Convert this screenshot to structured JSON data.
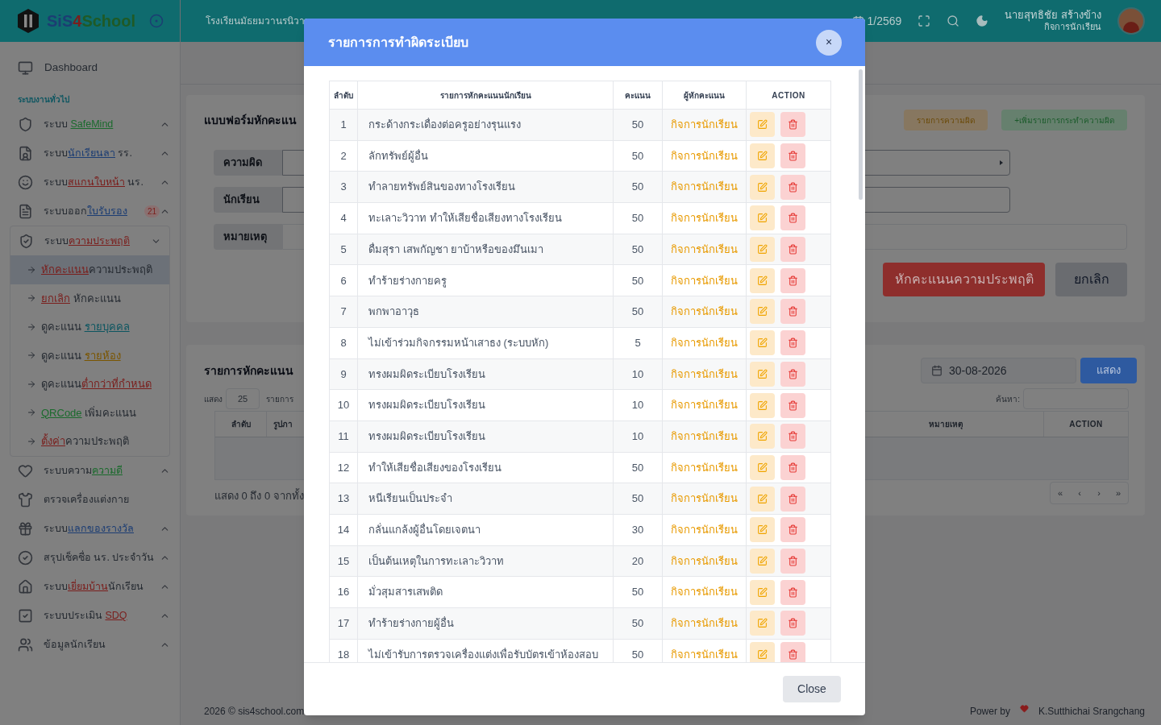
{
  "brand": {
    "parts": [
      {
        "text": "SiS",
        "color": "#1c3d73"
      },
      {
        "text": "4",
        "color": "#7a1e1c"
      },
      {
        "text": "School",
        "color": "#1f5a26"
      }
    ]
  },
  "topbar": {
    "school": "โรงเรียนมัธยมวานรนิวา",
    "term": "1/2569",
    "user_name": "นายสุทธิชัย สร้างข้าง",
    "user_role": "กิจการนักเรียน"
  },
  "sidebar": {
    "dashboard": "Dashboard",
    "section": "ระบบงานทั่วไป",
    "items": [
      {
        "kind": "group",
        "expanded": false,
        "parts": [
          {
            "text": "ระบบ "
          },
          {
            "text": "SafeMind",
            "color": "#1a6a2c"
          }
        ]
      },
      {
        "kind": "group",
        "expanded": false,
        "parts": [
          {
            "text": "ระบบ"
          },
          {
            "text": "นักเรียนลา",
            "color": "#1c3d73"
          },
          {
            "text": " รร."
          }
        ]
      },
      {
        "kind": "group",
        "expanded": false,
        "parts": [
          {
            "text": "ระบบ"
          },
          {
            "text": "สแกนใบหน้า",
            "color": "#7a1e1c"
          },
          {
            "text": " นร."
          }
        ]
      },
      {
        "kind": "group",
        "expanded": false,
        "badge": "21",
        "parts": [
          {
            "text": "ระบบออก"
          },
          {
            "text": "ใบรับรอง",
            "color": "#1c3d73"
          }
        ]
      },
      {
        "kind": "group",
        "expanded": true,
        "parts": [
          {
            "text": "ระบบ"
          },
          {
            "text": "ความประพฤติ",
            "color": "#7a1e1c"
          }
        ],
        "children": [
          {
            "selected": true,
            "parts": [
              {
                "text": "หักคะแนน",
                "color": "#7a1e1c"
              },
              {
                "text": "ความประพฤติ"
              }
            ]
          },
          {
            "selected": false,
            "parts": [
              {
                "text": "ยกเลิก",
                "color": "#7a1e1c"
              },
              {
                "text": " หักคะแนน"
              }
            ]
          },
          {
            "selected": false,
            "parts": [
              {
                "text": "ดูคะแนน "
              },
              {
                "text": "รายบุคคล",
                "color": "#0c5560"
              }
            ]
          },
          {
            "selected": false,
            "parts": [
              {
                "text": "ดูคะแนน "
              },
              {
                "text": "รายห้อง",
                "color": "#7a5500"
              }
            ]
          },
          {
            "selected": false,
            "parts": [
              {
                "text": "ดูคะแนน"
              },
              {
                "text": "ต่ำกว่าที่กำหนด",
                "color": "#7a1e1c"
              }
            ]
          },
          {
            "selected": false,
            "parts": [
              {
                "text": "QRCode",
                "color": "#1a6a2c"
              },
              {
                "text": " เพิ่มคะแนน"
              }
            ]
          },
          {
            "selected": false,
            "parts": [
              {
                "text": "ตั้งค่า",
                "color": "#7a1e1c"
              },
              {
                "text": "ความประพฤติ"
              }
            ]
          }
        ]
      },
      {
        "kind": "group",
        "expanded": false,
        "parts": [
          {
            "text": "ระบบความ"
          },
          {
            "text": "ความดี",
            "color": "#1a6a2c"
          }
        ]
      },
      {
        "kind": "link",
        "parts": [
          {
            "text": "ตรวจเครื่องแต่งกาย"
          }
        ]
      },
      {
        "kind": "group",
        "expanded": false,
        "parts": [
          {
            "text": "ระบบ"
          },
          {
            "text": "แลกของรางวัล",
            "color": "#1c3d73"
          }
        ]
      },
      {
        "kind": "group",
        "expanded": false,
        "parts": [
          {
            "text": "สรุปเช็คชื่อ นร. ประจำวัน"
          }
        ]
      },
      {
        "kind": "group",
        "expanded": false,
        "parts": [
          {
            "text": "ระบบ"
          },
          {
            "text": "เยี่ยมบ้าน",
            "color": "#7a1e1c"
          },
          {
            "text": "นักเรียน"
          }
        ]
      },
      {
        "kind": "group",
        "expanded": false,
        "parts": [
          {
            "text": "ระบบประเมิน "
          },
          {
            "text": "SDQ",
            "color": "#7a1e1c"
          }
        ]
      },
      {
        "kind": "group",
        "expanded": false,
        "parts": [
          {
            "text": "ข้อมูลนักเรียน"
          }
        ]
      }
    ]
  },
  "form_card": {
    "title": "แบบฟอร์มหักคะแน",
    "list_button": "รายการความผิด",
    "add_button": "+เพิ่มรายการกระทำความผิด",
    "fields": [
      {
        "kind": "select",
        "label": "ความผิด"
      },
      {
        "kind": "input",
        "label": "นักเรียน"
      },
      {
        "kind": "wide",
        "label": "หมายเหตุ"
      }
    ],
    "submit": "หักคะแนนความประพฤติ",
    "cancel": "ยกเลิก"
  },
  "list_card": {
    "title": "รายการหักคะแนน",
    "show_label": "แสดง",
    "page_size": "25",
    "entries_label": "รายการ",
    "date": "30-08-2026",
    "show_button": "แสดง",
    "search_label": "ค้นหา:",
    "columns": [
      "ลำดับ",
      "รูปภา",
      "หมายเหตุ",
      "ACTION"
    ],
    "info": "แสดง 0 ถึง 0 จากทั้ง",
    "pagination": [
      "«",
      "‹",
      "›",
      "»"
    ]
  },
  "footer": {
    "copyright": "2026 © sis4school.com",
    "power": "Power by",
    "author": "K.Sutthichai Srangchang"
  },
  "modal": {
    "title": "รายการการทำผิดระเบียบ",
    "close_x": "×",
    "close_button": "Close",
    "columns": [
      "ลำดับ",
      "รายการหักคะแนนนักเรียน",
      "คะแนน",
      "ผู้หักคะแนน",
      "ACTION"
    ],
    "rows": [
      {
        "no": "1",
        "item": "กระด้างกระเดื่องต่อครูอย่างรุนแรง",
        "points": "50",
        "by": "กิจการนักเรียน"
      },
      {
        "no": "2",
        "item": "ลักทรัพย์ผู้อื่น",
        "points": "50",
        "by": "กิจการนักเรียน"
      },
      {
        "no": "3",
        "item": "ทำลายทรัพย์สินของทางโรงเรียน",
        "points": "50",
        "by": "กิจการนักเรียน"
      },
      {
        "no": "4",
        "item": "ทะเลาะวิวาท ทำให้เสียชื่อเสียงทางโรงเรียน",
        "points": "50",
        "by": "กิจการนักเรียน"
      },
      {
        "no": "5",
        "item": "ดื่มสุรา เสพกัญชา ยาบ้าหรือของมึนเมา",
        "points": "50",
        "by": "กิจการนักเรียน"
      },
      {
        "no": "6",
        "item": "ทำร้ายร่างกายครู",
        "points": "50",
        "by": "กิจการนักเรียน"
      },
      {
        "no": "7",
        "item": "พกพาอาวุธ",
        "points": "50",
        "by": "กิจการนักเรียน"
      },
      {
        "no": "8",
        "item": "ไม่เข้าร่วมกิจกรรมหน้าเสาธง (ระบบหัก)",
        "points": "5",
        "by": "กิจการนักเรียน"
      },
      {
        "no": "9",
        "item": "ทรงผมผิดระเบียบโรงเรียน",
        "points": "10",
        "by": "กิจการนักเรียน"
      },
      {
        "no": "10",
        "item": "ทรงผมผิดระเบียบโรงเรียน",
        "points": "10",
        "by": "กิจการนักเรียน"
      },
      {
        "no": "11",
        "item": "ทรงผมผิดระเบียบโรงเรียน",
        "points": "10",
        "by": "กิจการนักเรียน"
      },
      {
        "no": "12",
        "item": "ทำให้เสียชื่อเสียงของโรงเรียน",
        "points": "50",
        "by": "กิจการนักเรียน"
      },
      {
        "no": "13",
        "item": "หนีเรียนเป็นประจำ",
        "points": "50",
        "by": "กิจการนักเรียน"
      },
      {
        "no": "14",
        "item": "กลั่นแกล้งผู้อื่นโดยเจตนา",
        "points": "30",
        "by": "กิจการนักเรียน"
      },
      {
        "no": "15",
        "item": "เป็นต้นเหตุในการทะเลาะวิวาท",
        "points": "20",
        "by": "กิจการนักเรียน"
      },
      {
        "no": "16",
        "item": "มั่วสุมสารเสพติด",
        "points": "50",
        "by": "กิจการนักเรียน"
      },
      {
        "no": "17",
        "item": "ทำร้ายร่างกายผู้อื่น",
        "points": "50",
        "by": "กิจการนักเรียน"
      },
      {
        "no": "18",
        "item": "ไม่เข้ารับการตรวจเครื่องแต่งเพื่อรับบัตรเข้าห้องสอบ",
        "points": "50",
        "by": "กิจการนักเรียน"
      }
    ]
  }
}
